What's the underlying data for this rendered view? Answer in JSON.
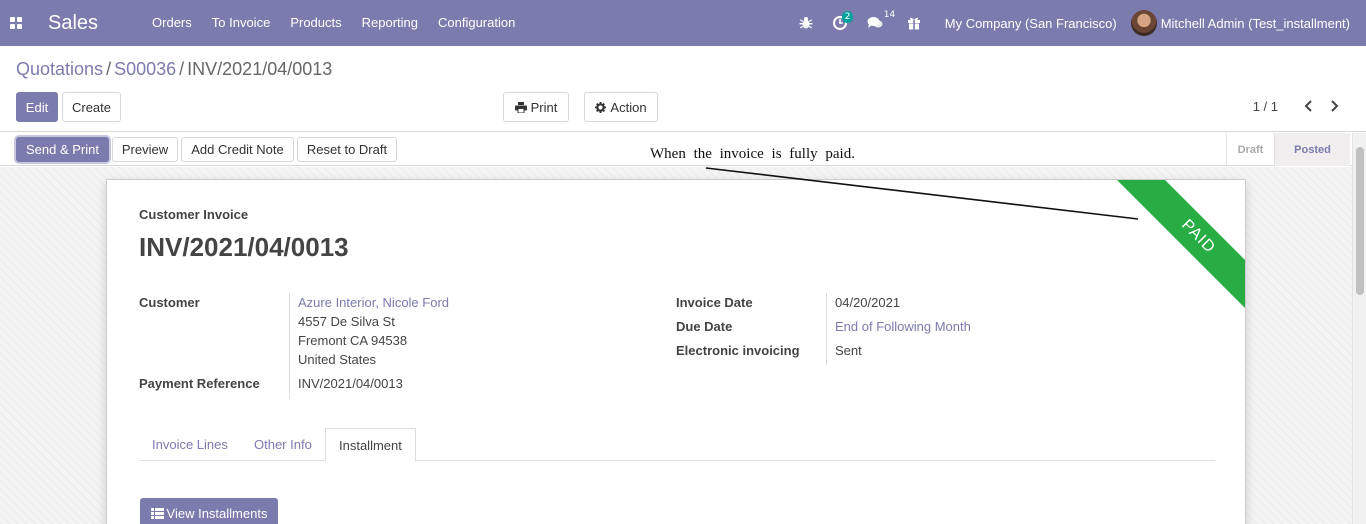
{
  "navbar": {
    "app_title": "Sales",
    "menu": [
      "Orders",
      "To Invoice",
      "Products",
      "Reporting",
      "Configuration"
    ],
    "activity_count": "2",
    "messages_count": "14",
    "company": "My Company (San Francisco)",
    "user": "Mitchell Admin (Test_installment)",
    "color": "#7c7bad"
  },
  "breadcrumb": {
    "items": [
      "Quotations",
      "S00036"
    ],
    "current": "INV/2021/04/0013"
  },
  "actions": {
    "edit": "Edit",
    "create": "Create",
    "print": "Print",
    "action": "Action"
  },
  "pager": {
    "value": "1 / 1"
  },
  "statusbar": {
    "send_print": "Send & Print",
    "preview": "Preview",
    "add_credit_note": "Add Credit Note",
    "reset_to_draft": "Reset to Draft",
    "stages": [
      "Draft",
      "Posted"
    ],
    "active_stage": "Posted"
  },
  "annotation": "When the invoice is fully paid.",
  "invoice": {
    "type_label": "Customer Invoice",
    "name": "INV/2021/04/0013",
    "ribbon": "PAID",
    "ribbon_color": "#27ad43",
    "customer_label": "Customer",
    "customer_name": "Azure Interior, Nicole Ford",
    "address_line1": "4557 De Silva St",
    "address_line2": "Fremont CA 94538",
    "address_line3": "United States",
    "payment_ref_label": "Payment Reference",
    "payment_ref": "INV/2021/04/0013",
    "invoice_date_label": "Invoice Date",
    "invoice_date": "04/20/2021",
    "due_date_label": "Due Date",
    "due_date": "End of Following Month",
    "einvoicing_label": "Electronic invoicing",
    "einvoicing": "Sent"
  },
  "tabs": [
    "Invoice Lines",
    "Other Info",
    "Installment"
  ],
  "active_tab": "Installment",
  "view_installments": "View Installments"
}
